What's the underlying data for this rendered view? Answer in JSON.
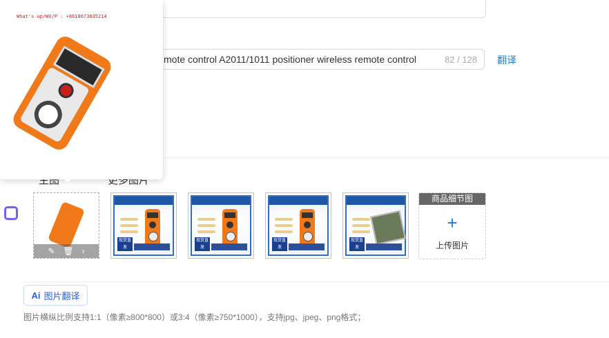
{
  "title_field": {
    "value": "mote control A2011/1011 positioner wireless remote control",
    "count": "82 / 128"
  },
  "translate_label": "翻译",
  "tabs": [
    "主图",
    "更多图片"
  ],
  "main_image": {
    "watermark": "What's up/WX/P : +8618673035214",
    "actions": [
      "edit-icon",
      "trash-icon",
      "move-icon"
    ]
  },
  "thumbnails": [
    {
      "kind": "remote",
      "badge": "现货直发"
    },
    {
      "kind": "remote",
      "badge": "现货直发"
    },
    {
      "kind": "remote",
      "badge": "现货直发"
    },
    {
      "kind": "pcb",
      "badge": "现货直发"
    }
  ],
  "upload_box": {
    "header": "商品细节图",
    "plus": "+",
    "label": "上传图片"
  },
  "ai_button": {
    "mark": "Ai",
    "label": "图片翻译"
  },
  "hint_text": "图片横纵比例支持1:1（像素≥800*800）或3:4（像素≥750*1000），支持jpg、jpeg、png格式；",
  "colors": {
    "link": "#1e7fd9",
    "accent": "#2b5fd9",
    "product_orange": "#f07a1a"
  }
}
